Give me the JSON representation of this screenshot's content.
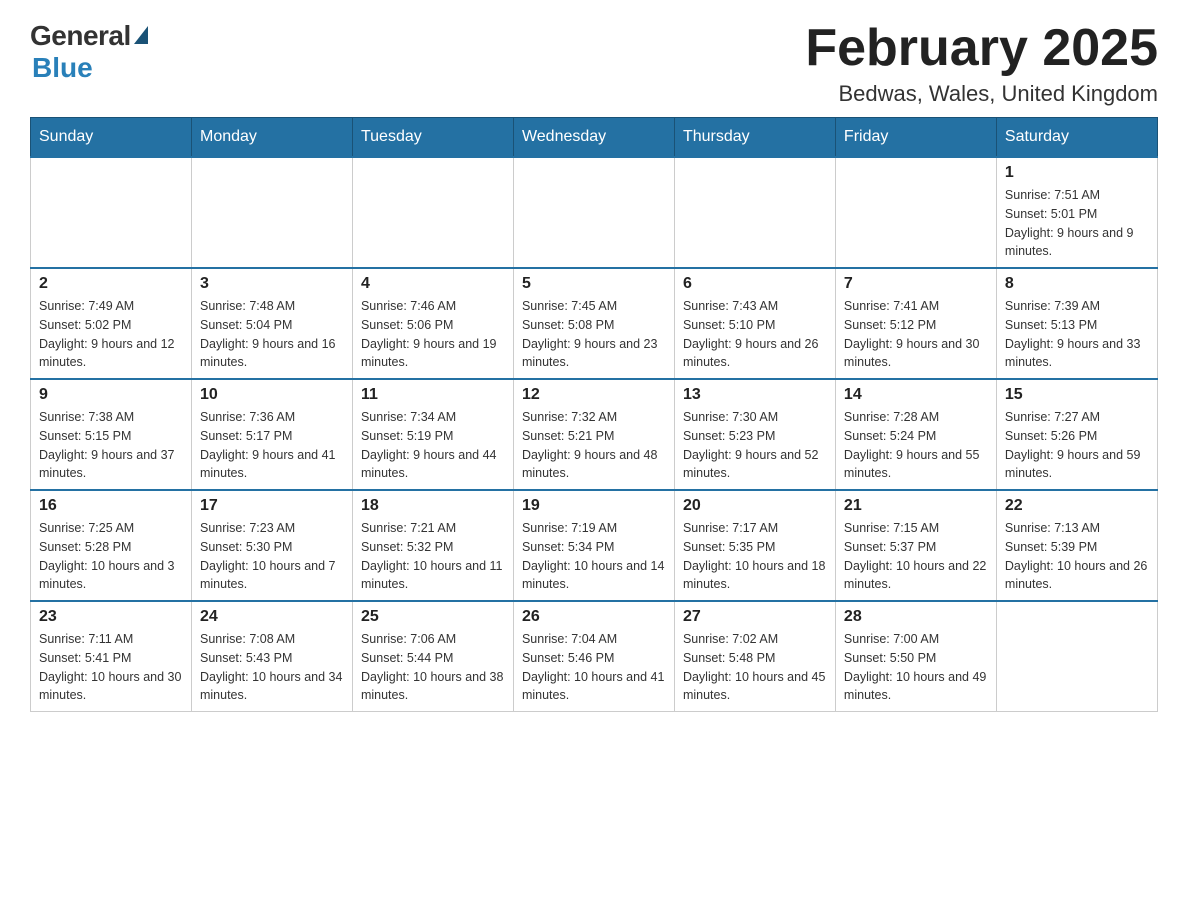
{
  "header": {
    "logo_general": "General",
    "logo_blue": "Blue",
    "title": "February 2025",
    "location": "Bedwas, Wales, United Kingdom"
  },
  "days_of_week": [
    "Sunday",
    "Monday",
    "Tuesday",
    "Wednesday",
    "Thursday",
    "Friday",
    "Saturday"
  ],
  "weeks": [
    [
      {
        "day": "",
        "info": ""
      },
      {
        "day": "",
        "info": ""
      },
      {
        "day": "",
        "info": ""
      },
      {
        "day": "",
        "info": ""
      },
      {
        "day": "",
        "info": ""
      },
      {
        "day": "",
        "info": ""
      },
      {
        "day": "1",
        "info": "Sunrise: 7:51 AM\nSunset: 5:01 PM\nDaylight: 9 hours and 9 minutes."
      }
    ],
    [
      {
        "day": "2",
        "info": "Sunrise: 7:49 AM\nSunset: 5:02 PM\nDaylight: 9 hours and 12 minutes."
      },
      {
        "day": "3",
        "info": "Sunrise: 7:48 AM\nSunset: 5:04 PM\nDaylight: 9 hours and 16 minutes."
      },
      {
        "day": "4",
        "info": "Sunrise: 7:46 AM\nSunset: 5:06 PM\nDaylight: 9 hours and 19 minutes."
      },
      {
        "day": "5",
        "info": "Sunrise: 7:45 AM\nSunset: 5:08 PM\nDaylight: 9 hours and 23 minutes."
      },
      {
        "day": "6",
        "info": "Sunrise: 7:43 AM\nSunset: 5:10 PM\nDaylight: 9 hours and 26 minutes."
      },
      {
        "day": "7",
        "info": "Sunrise: 7:41 AM\nSunset: 5:12 PM\nDaylight: 9 hours and 30 minutes."
      },
      {
        "day": "8",
        "info": "Sunrise: 7:39 AM\nSunset: 5:13 PM\nDaylight: 9 hours and 33 minutes."
      }
    ],
    [
      {
        "day": "9",
        "info": "Sunrise: 7:38 AM\nSunset: 5:15 PM\nDaylight: 9 hours and 37 minutes."
      },
      {
        "day": "10",
        "info": "Sunrise: 7:36 AM\nSunset: 5:17 PM\nDaylight: 9 hours and 41 minutes."
      },
      {
        "day": "11",
        "info": "Sunrise: 7:34 AM\nSunset: 5:19 PM\nDaylight: 9 hours and 44 minutes."
      },
      {
        "day": "12",
        "info": "Sunrise: 7:32 AM\nSunset: 5:21 PM\nDaylight: 9 hours and 48 minutes."
      },
      {
        "day": "13",
        "info": "Sunrise: 7:30 AM\nSunset: 5:23 PM\nDaylight: 9 hours and 52 minutes."
      },
      {
        "day": "14",
        "info": "Sunrise: 7:28 AM\nSunset: 5:24 PM\nDaylight: 9 hours and 55 minutes."
      },
      {
        "day": "15",
        "info": "Sunrise: 7:27 AM\nSunset: 5:26 PM\nDaylight: 9 hours and 59 minutes."
      }
    ],
    [
      {
        "day": "16",
        "info": "Sunrise: 7:25 AM\nSunset: 5:28 PM\nDaylight: 10 hours and 3 minutes."
      },
      {
        "day": "17",
        "info": "Sunrise: 7:23 AM\nSunset: 5:30 PM\nDaylight: 10 hours and 7 minutes."
      },
      {
        "day": "18",
        "info": "Sunrise: 7:21 AM\nSunset: 5:32 PM\nDaylight: 10 hours and 11 minutes."
      },
      {
        "day": "19",
        "info": "Sunrise: 7:19 AM\nSunset: 5:34 PM\nDaylight: 10 hours and 14 minutes."
      },
      {
        "day": "20",
        "info": "Sunrise: 7:17 AM\nSunset: 5:35 PM\nDaylight: 10 hours and 18 minutes."
      },
      {
        "day": "21",
        "info": "Sunrise: 7:15 AM\nSunset: 5:37 PM\nDaylight: 10 hours and 22 minutes."
      },
      {
        "day": "22",
        "info": "Sunrise: 7:13 AM\nSunset: 5:39 PM\nDaylight: 10 hours and 26 minutes."
      }
    ],
    [
      {
        "day": "23",
        "info": "Sunrise: 7:11 AM\nSunset: 5:41 PM\nDaylight: 10 hours and 30 minutes."
      },
      {
        "day": "24",
        "info": "Sunrise: 7:08 AM\nSunset: 5:43 PM\nDaylight: 10 hours and 34 minutes."
      },
      {
        "day": "25",
        "info": "Sunrise: 7:06 AM\nSunset: 5:44 PM\nDaylight: 10 hours and 38 minutes."
      },
      {
        "day": "26",
        "info": "Sunrise: 7:04 AM\nSunset: 5:46 PM\nDaylight: 10 hours and 41 minutes."
      },
      {
        "day": "27",
        "info": "Sunrise: 7:02 AM\nSunset: 5:48 PM\nDaylight: 10 hours and 45 minutes."
      },
      {
        "day": "28",
        "info": "Sunrise: 7:00 AM\nSunset: 5:50 PM\nDaylight: 10 hours and 49 minutes."
      },
      {
        "day": "",
        "info": ""
      }
    ]
  ]
}
